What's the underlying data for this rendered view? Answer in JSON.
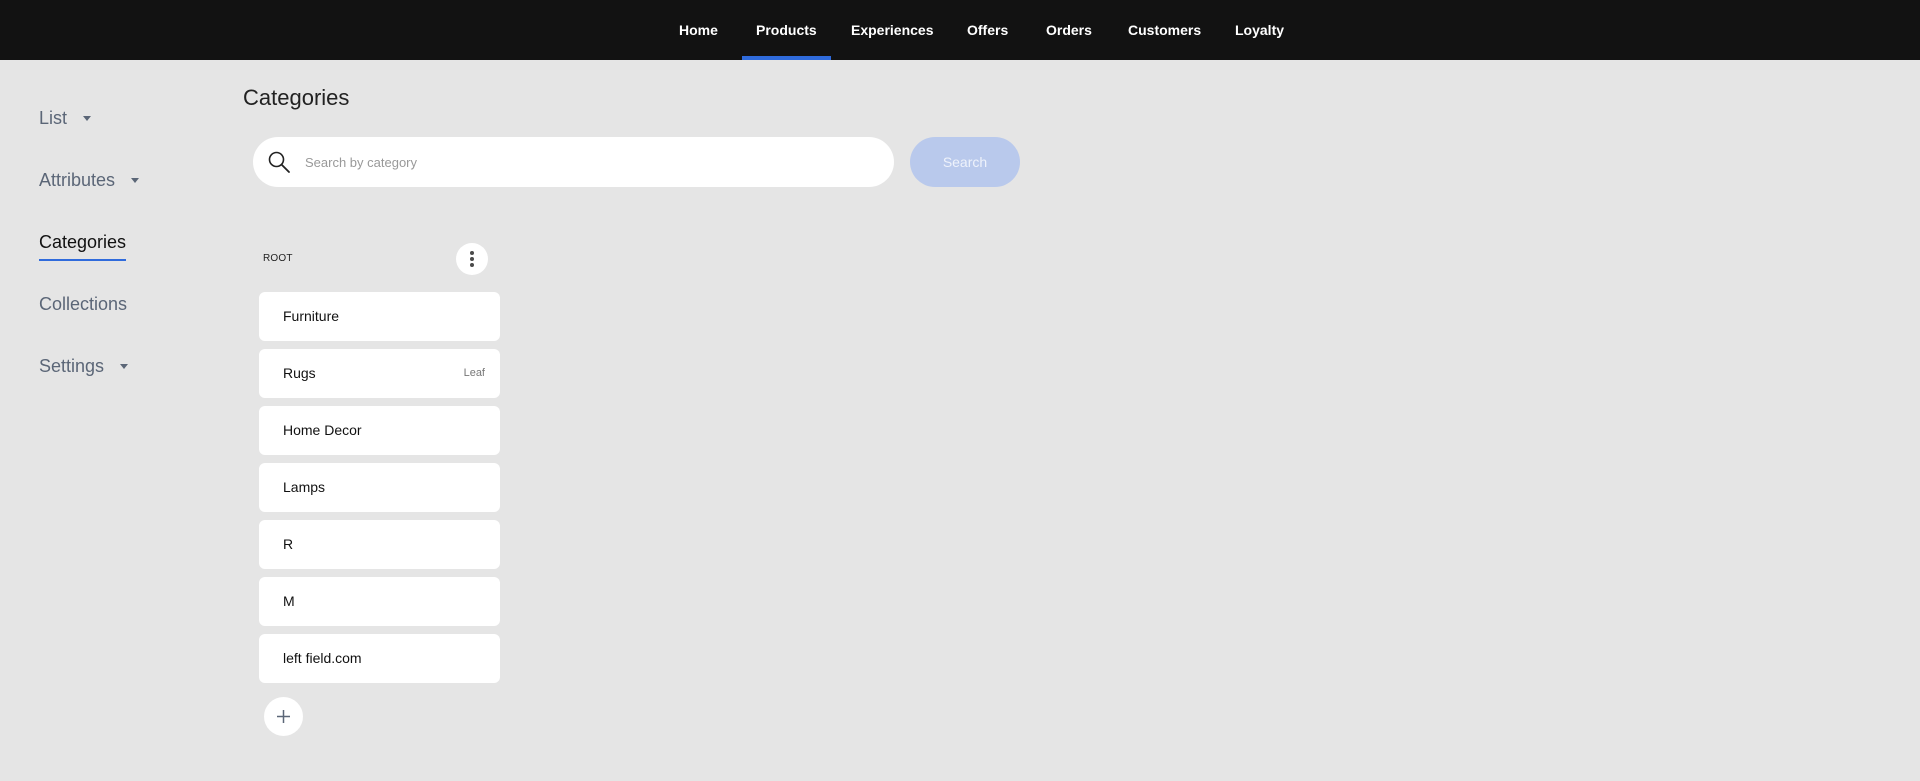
{
  "topnav": {
    "items": [
      {
        "label": "Home"
      },
      {
        "label": "Products",
        "active": true
      },
      {
        "label": "Experiences"
      },
      {
        "label": "Offers"
      },
      {
        "label": "Orders"
      },
      {
        "label": "Customers"
      },
      {
        "label": "Loyalty"
      }
    ]
  },
  "sidebar": {
    "items": [
      {
        "label": "List",
        "has_caret": true
      },
      {
        "label": "Attributes",
        "has_caret": true
      },
      {
        "label": "Categories",
        "active": true
      },
      {
        "label": "Collections"
      },
      {
        "label": "Settings",
        "has_caret": true
      }
    ]
  },
  "main": {
    "title": "Categories",
    "search": {
      "placeholder": "Search by category",
      "value": "",
      "button_label": "Search"
    },
    "tree": {
      "root_label": "ROOT",
      "items": [
        {
          "name": "Furniture",
          "badge": ""
        },
        {
          "name": "Rugs",
          "badge": "Leaf"
        },
        {
          "name": "Home Decor",
          "badge": ""
        },
        {
          "name": "Lamps",
          "badge": ""
        },
        {
          "name": "R",
          "badge": ""
        },
        {
          "name": "M",
          "badge": ""
        },
        {
          "name": "left field.com",
          "badge": ""
        }
      ]
    }
  },
  "colors": {
    "topbar_bg": "#121212",
    "accent": "#2f6bdc",
    "page_bg": "#e5e5e5",
    "search_button_bg": "#b9c9ec"
  },
  "icons": {
    "search": "search-icon",
    "menu": "kebab-menu-icon",
    "add": "plus-icon",
    "caret": "caret-down-icon"
  }
}
